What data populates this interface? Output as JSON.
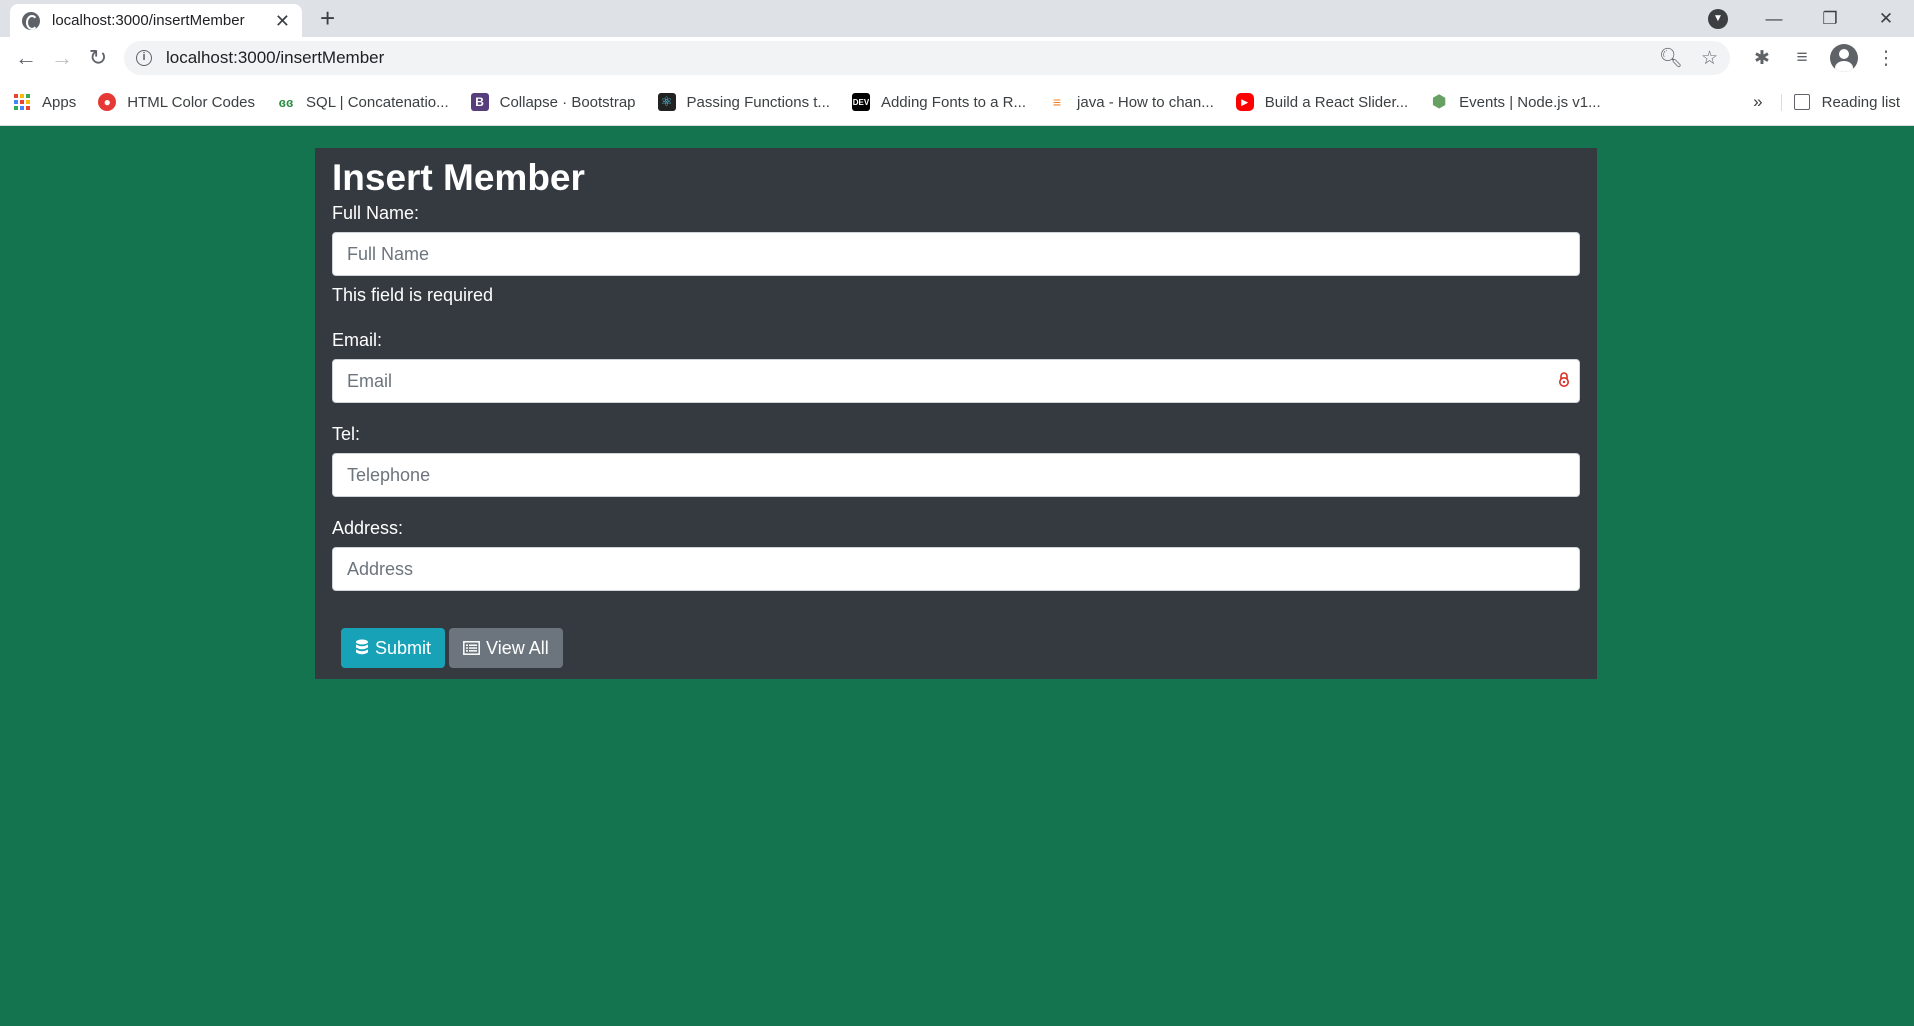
{
  "browser": {
    "tab_title": "localhost:3000/insertMember",
    "url": "localhost:3000/insertMember",
    "new_tab_glyph": "+",
    "window_controls": {
      "minimize": "—",
      "maximize": "❐",
      "close": "✕"
    },
    "bookmarks": [
      {
        "label": "Apps",
        "icon": "apps-grid-icon"
      },
      {
        "label": "HTML Color Codes",
        "icon": "color-codes-icon",
        "color": "#e53935"
      },
      {
        "label": "SQL | Concatenatio...",
        "icon": "geeksforgeeks-icon",
        "color": "#2f8d46"
      },
      {
        "label": "Collapse · Bootstrap",
        "icon": "bootstrap-icon",
        "color": "#563d7c"
      },
      {
        "label": "Passing Functions t...",
        "icon": "react-icon",
        "color": "#222222"
      },
      {
        "label": "Adding Fonts to a R...",
        "icon": "dev-icon",
        "color": "#000000"
      },
      {
        "label": "java - How to chan...",
        "icon": "stackoverflow-icon",
        "color": "#f48024"
      },
      {
        "label": "Build a React Slider...",
        "icon": "youtube-icon",
        "color": "#ff0000"
      },
      {
        "label": "Events | Node.js v1...",
        "icon": "nodejs-icon",
        "color": "#68a063"
      }
    ],
    "reading_list": "Reading list"
  },
  "form": {
    "title": "Insert Member",
    "fullname": {
      "label": "Full Name:",
      "placeholder": "Full Name",
      "value": "",
      "error": "This field is required"
    },
    "email": {
      "label": "Email:",
      "placeholder": "Email",
      "value": ""
    },
    "tel": {
      "label": "Tel:",
      "placeholder": "Telephone",
      "value": ""
    },
    "address": {
      "label": "Address:",
      "placeholder": "Address",
      "value": ""
    },
    "submit_label": "Submit",
    "viewall_label": "View All"
  },
  "colors": {
    "page_bg": "#13744f",
    "card_bg": "#343a40",
    "submit_bg": "#17a2b8",
    "viewall_bg": "#6c757d"
  }
}
